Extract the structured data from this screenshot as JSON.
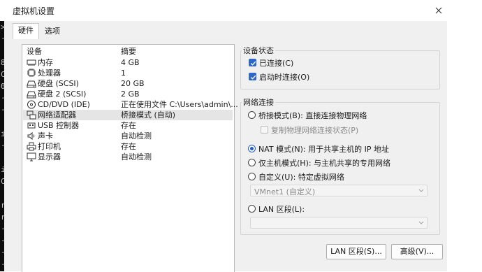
{
  "background_strip": {
    "chars": [
      ">",
      "·",
      "",
      "8",
      "C",
      "0",
      "·",
      "·",
      "",
      "i",
      "·",
      "",
      "i",
      "C",
      "",
      "r",
      "r",
      "·",
      "·",
      "·",
      "·"
    ]
  },
  "window": {
    "title": "虚拟机设置",
    "close_icon": "close-icon"
  },
  "tabs": [
    {
      "label": "硬件",
      "active": true
    },
    {
      "label": "选项",
      "active": false
    }
  ],
  "devices": {
    "headers": {
      "device": "设备",
      "summary": "摘要"
    },
    "rows": [
      {
        "name": "内存",
        "summary": "4 GB",
        "icon": "memory-icon",
        "selected": false
      },
      {
        "name": "处理器",
        "summary": "1",
        "icon": "cpu-icon",
        "selected": false
      },
      {
        "name": "硬盘 (SCSI)",
        "summary": "20 GB",
        "icon": "hard-disk-icon",
        "selected": false
      },
      {
        "name": "硬盘 2 (SCSI)",
        "summary": "2 GB",
        "icon": "hard-disk-icon",
        "selected": false
      },
      {
        "name": "CD/DVD (IDE)",
        "summary": "正在使用文件 C:\\Users\\admin\\...",
        "icon": "cd-dvd-icon",
        "selected": false
      },
      {
        "name": "网络适配器",
        "summary": "桥接模式 (自动)",
        "icon": "network-adapter-icon",
        "selected": true
      },
      {
        "name": "USB 控制器",
        "summary": "存在",
        "icon": "usb-icon",
        "selected": false
      },
      {
        "name": "声卡",
        "summary": "自动检测",
        "icon": "speaker-icon",
        "selected": false
      },
      {
        "name": "打印机",
        "summary": "存在",
        "icon": "printer-icon",
        "selected": false
      },
      {
        "name": "显示器",
        "summary": "自动检测",
        "icon": "monitor-icon",
        "selected": false
      }
    ]
  },
  "device_status": {
    "title": "设备状态",
    "connected": {
      "label": "已连接(C)",
      "checked": true
    },
    "connect_at_power_on": {
      "label": "启动时连接(O)",
      "checked": true
    }
  },
  "network_connection": {
    "title": "网络连接",
    "bridged": {
      "label": "桥接模式(B): 直接连接物理网络",
      "selected": false
    },
    "replicate": {
      "label": "复制物理网络连接状态(P)",
      "checked": false,
      "disabled": true
    },
    "nat": {
      "label": "NAT 模式(N): 用于共享主机的 IP 地址",
      "selected": true
    },
    "host_only": {
      "label": "仅主机模式(H): 与主机共享的专用网络",
      "selected": false
    },
    "custom": {
      "label": "自定义(U): 特定虚拟网络",
      "selected": false
    },
    "vmnet_select": {
      "value": "VMnet1 (自定义)"
    },
    "lan_segment": {
      "label": "LAN 区段(L):",
      "selected": false
    },
    "lan_select": {
      "value": ""
    }
  },
  "buttons": {
    "lan_segments": "LAN 区段(S)...",
    "advanced": "高级(V)..."
  },
  "colors": {
    "accent": "#2b68c8",
    "selection": "#e5e5e5",
    "window_bg": "#f0f0f0"
  }
}
